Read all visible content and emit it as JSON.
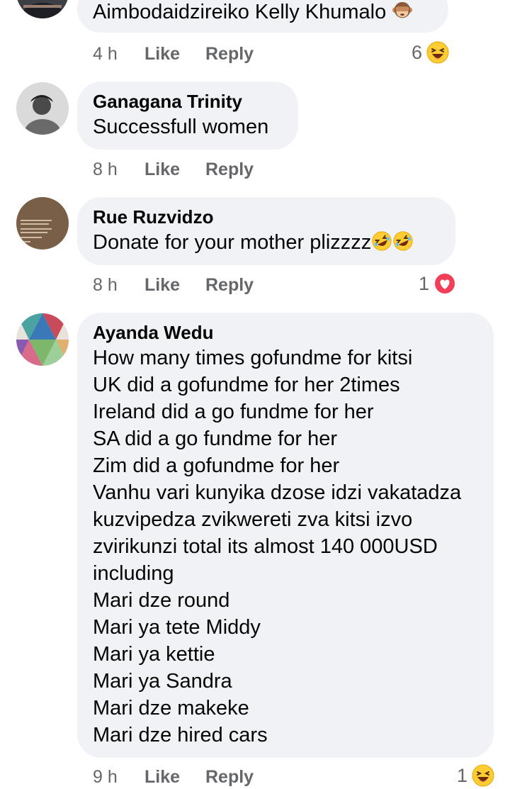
{
  "comments": [
    {
      "author": "",
      "lines": [
        "Aimbodaidzireiko Kelly Khumalo"
      ],
      "time": "4 h",
      "like_label": "Like",
      "reply_label": "Reply",
      "reaction_count": "6",
      "reaction_icon": "laughing-emoji-icon",
      "inline_emoji": "see-no-evil-monkey-icon"
    },
    {
      "author": "Ganagana Trinity",
      "lines": [
        "Successfull women"
      ],
      "time": "8 h",
      "like_label": "Like",
      "reply_label": "Reply",
      "reaction_count": "",
      "reaction_icon": ""
    },
    {
      "author": "Rue Ruzvidzo",
      "lines": [
        "Donate for your mother plizzzz"
      ],
      "time": "8 h",
      "like_label": "Like",
      "reply_label": "Reply",
      "reaction_count": "1",
      "reaction_icon": "love-heart-icon",
      "inline_emoji": "rolling-laughing-emoji-icon"
    },
    {
      "author": "Ayanda Wedu",
      "lines": [
        "How many times gofundme for kitsi",
        "UK did a gofundme for her 2times",
        "Ireland did a go fundme for her",
        "SA did a go fundme for her",
        "Zim did a gofundme for her",
        "Vanhu vari kunyika dzose idzi vakatadza",
        "kuzvipedza zvikwereti zva kitsi izvo",
        "zvirikunzi total its almost 140 000USD",
        "including",
        "Mari dze round",
        "Mari ya tete Middy",
        "Mari ya kettie",
        "Mari ya Sandra",
        "Mari dze makeke",
        "Mari dze hired cars"
      ],
      "time": "9 h",
      "like_label": "Like",
      "reply_label": "Reply",
      "reaction_count": "1",
      "reaction_icon": "laughing-emoji-icon"
    }
  ],
  "colors": {
    "bubble": "#f0f2f5",
    "meta_text": "#65676b",
    "text": "#050505",
    "love": "#f33e58",
    "emoji_yellow": "#ffcc33"
  }
}
